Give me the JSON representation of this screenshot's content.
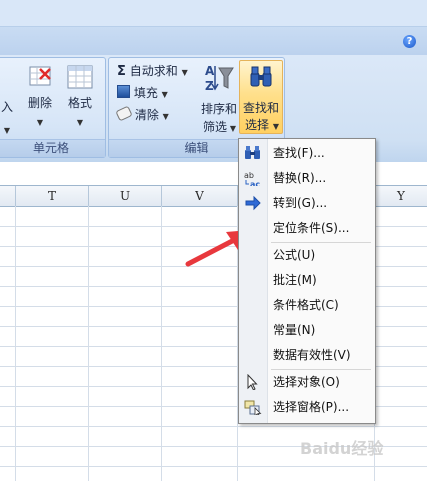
{
  "ribbon": {
    "cells_group": {
      "group_label": "单元格",
      "delete_label": "删除",
      "format_label": "格式",
      "partial_label": "入"
    },
    "editing_group": {
      "group_label": "编辑",
      "autosum_label": "自动求和",
      "fill_label": "填充",
      "clear_label": "清除",
      "sort_filter_line1": "排序和",
      "sort_filter_line2": "筛选",
      "find_select_line1": "查找和",
      "find_select_line2": "选择"
    }
  },
  "sheet": {
    "columns": [
      "T",
      "U",
      "V",
      "Y"
    ]
  },
  "menu": {
    "items": [
      {
        "label": "查找(F)...",
        "icon": "binoculars-icon"
      },
      {
        "label": "替换(R)...",
        "icon": "replace-abc-icon"
      },
      {
        "label": "转到(G)...",
        "icon": "arrow-right-icon"
      },
      {
        "label": "定位条件(S)...",
        "icon": ""
      },
      {
        "label": "公式(U)",
        "icon": ""
      },
      {
        "label": "批注(M)",
        "icon": ""
      },
      {
        "label": "条件格式(C)",
        "icon": ""
      },
      {
        "label": "常量(N)",
        "icon": ""
      },
      {
        "label": "数据有效性(V)",
        "icon": ""
      },
      {
        "label": "选择对象(O)",
        "icon": "cursor-icon"
      },
      {
        "label": "选择窗格(P)...",
        "icon": "selection-pane-icon"
      }
    ]
  },
  "watermark": {
    "text": "Baidu经验"
  },
  "colors": {
    "annotation_arrow": "#e8383d",
    "menu_highlight_button": "#ffd060"
  }
}
